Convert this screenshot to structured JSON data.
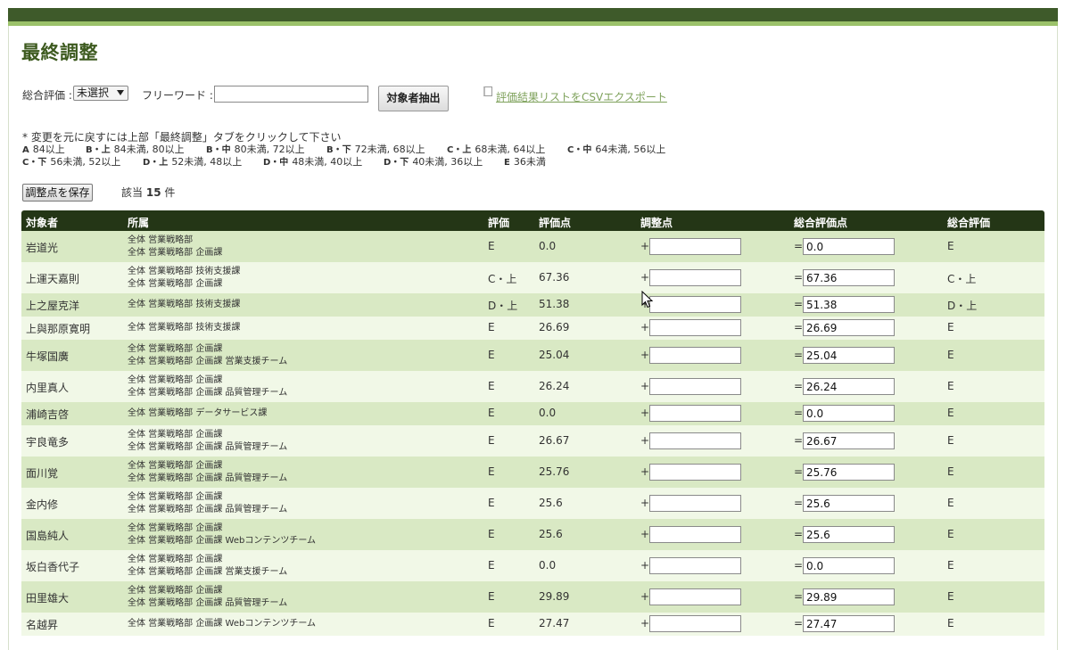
{
  "page": {
    "title": "最終調整"
  },
  "filters": {
    "overall_label": "総合評価 :",
    "overall_selected": "未選択",
    "keyword_label": "フリーワード :",
    "keyword_value": "",
    "extract_button": "対象者抽出",
    "csv_link": "評価結果リストをCSVエクスポート"
  },
  "note": "* 変更を元に戻すには上部「最終調整」タブをクリックして下さい",
  "legend": {
    "line1": [
      {
        "grade": "A",
        "range": "84以上"
      },
      {
        "grade": "B・上",
        "range": "84未満, 80以上"
      },
      {
        "grade": "B・中",
        "range": "80未満, 72以上"
      },
      {
        "grade": "B・下",
        "range": "72未満, 68以上"
      },
      {
        "grade": "C・上",
        "range": "68未満, 64以上"
      },
      {
        "grade": "C・中",
        "range": "64未満, 56以上"
      }
    ],
    "line2": [
      {
        "grade": "C・下",
        "range": "56未満, 52以上"
      },
      {
        "grade": "D・上",
        "range": "52未満, 48以上"
      },
      {
        "grade": "D・中",
        "range": "48未満, 40以上"
      },
      {
        "grade": "D・下",
        "range": "40未満, 36以上"
      },
      {
        "grade": "E",
        "range": "36未満"
      }
    ]
  },
  "save_button": "調整点を保存",
  "count": {
    "prefix": "該当",
    "value": "15",
    "suffix": "件"
  },
  "table": {
    "columns": [
      "対象者",
      "所属",
      "評価",
      "評価点",
      "調整点",
      "総合評価点",
      "総合評価"
    ],
    "plus": "+",
    "equals": "=",
    "rows": [
      {
        "name": "岩道光",
        "depts": [
          "全体 営業戦略部",
          "全体 営業戦略部 企画課"
        ],
        "grade": "E",
        "score": "0.0",
        "adjust": "",
        "total": "0.0",
        "overall": "E"
      },
      {
        "name": "上運天嘉則",
        "depts": [
          "全体 営業戦略部 技術支援課",
          "全体 営業戦略部 企画課"
        ],
        "grade": "C・上",
        "score": "67.36",
        "adjust": "",
        "total": "67.36",
        "overall": "C・上"
      },
      {
        "name": "上之屋克洋",
        "depts": [
          "全体 営業戦略部 技術支援課"
        ],
        "grade": "D・上",
        "score": "51.38",
        "adjust": "",
        "total": "51.38",
        "overall": "D・上"
      },
      {
        "name": "上與那原寛明",
        "depts": [
          "全体 営業戦略部 技術支援課"
        ],
        "grade": "E",
        "score": "26.69",
        "adjust": "",
        "total": "26.69",
        "overall": "E"
      },
      {
        "name": "牛塚国廣",
        "depts": [
          "全体 営業戦略部 企画課",
          "全体 営業戦略部 企画課 営業支援チーム"
        ],
        "grade": "E",
        "score": "25.04",
        "adjust": "",
        "total": "25.04",
        "overall": "E"
      },
      {
        "name": "内里真人",
        "depts": [
          "全体 営業戦略部 企画課",
          "全体 営業戦略部 企画課 品質管理チーム"
        ],
        "grade": "E",
        "score": "26.24",
        "adjust": "",
        "total": "26.24",
        "overall": "E"
      },
      {
        "name": "浦崎吉啓",
        "depts": [
          "全体 営業戦略部 データサービス課"
        ],
        "grade": "E",
        "score": "0.0",
        "adjust": "",
        "total": "0.0",
        "overall": "E"
      },
      {
        "name": "宇良竜多",
        "depts": [
          "全体 営業戦略部 企画課",
          "全体 営業戦略部 企画課 品質管理チーム"
        ],
        "grade": "E",
        "score": "26.67",
        "adjust": "",
        "total": "26.67",
        "overall": "E"
      },
      {
        "name": "面川覚",
        "depts": [
          "全体 営業戦略部 企画課",
          "全体 営業戦略部 企画課 品質管理チーム"
        ],
        "grade": "E",
        "score": "25.76",
        "adjust": "",
        "total": "25.76",
        "overall": "E"
      },
      {
        "name": "金内修",
        "depts": [
          "全体 営業戦略部 企画課",
          "全体 営業戦略部 企画課 品質管理チーム"
        ],
        "grade": "E",
        "score": "25.6",
        "adjust": "",
        "total": "25.6",
        "overall": "E"
      },
      {
        "name": "国島純人",
        "depts": [
          "全体 営業戦略部 企画課",
          "全体 営業戦略部 企画課 Webコンテンツチーム"
        ],
        "grade": "E",
        "score": "25.6",
        "adjust": "",
        "total": "25.6",
        "overall": "E"
      },
      {
        "name": "坂白香代子",
        "depts": [
          "全体 営業戦略部 企画課",
          "全体 営業戦略部 企画課 営業支援チーム"
        ],
        "grade": "E",
        "score": "0.0",
        "adjust": "",
        "total": "0.0",
        "overall": "E"
      },
      {
        "name": "田里雄大",
        "depts": [
          "全体 営業戦略部 企画課",
          "全体 営業戦略部 企画課 品質管理チーム"
        ],
        "grade": "E",
        "score": "29.89",
        "adjust": "",
        "total": "29.89",
        "overall": "E"
      },
      {
        "name": "名越昇",
        "depts": [
          "全体 営業戦略部 企画課 Webコンテンツチーム"
        ],
        "grade": "E",
        "score": "27.47",
        "adjust": "",
        "total": "27.47",
        "overall": "E"
      }
    ]
  }
}
